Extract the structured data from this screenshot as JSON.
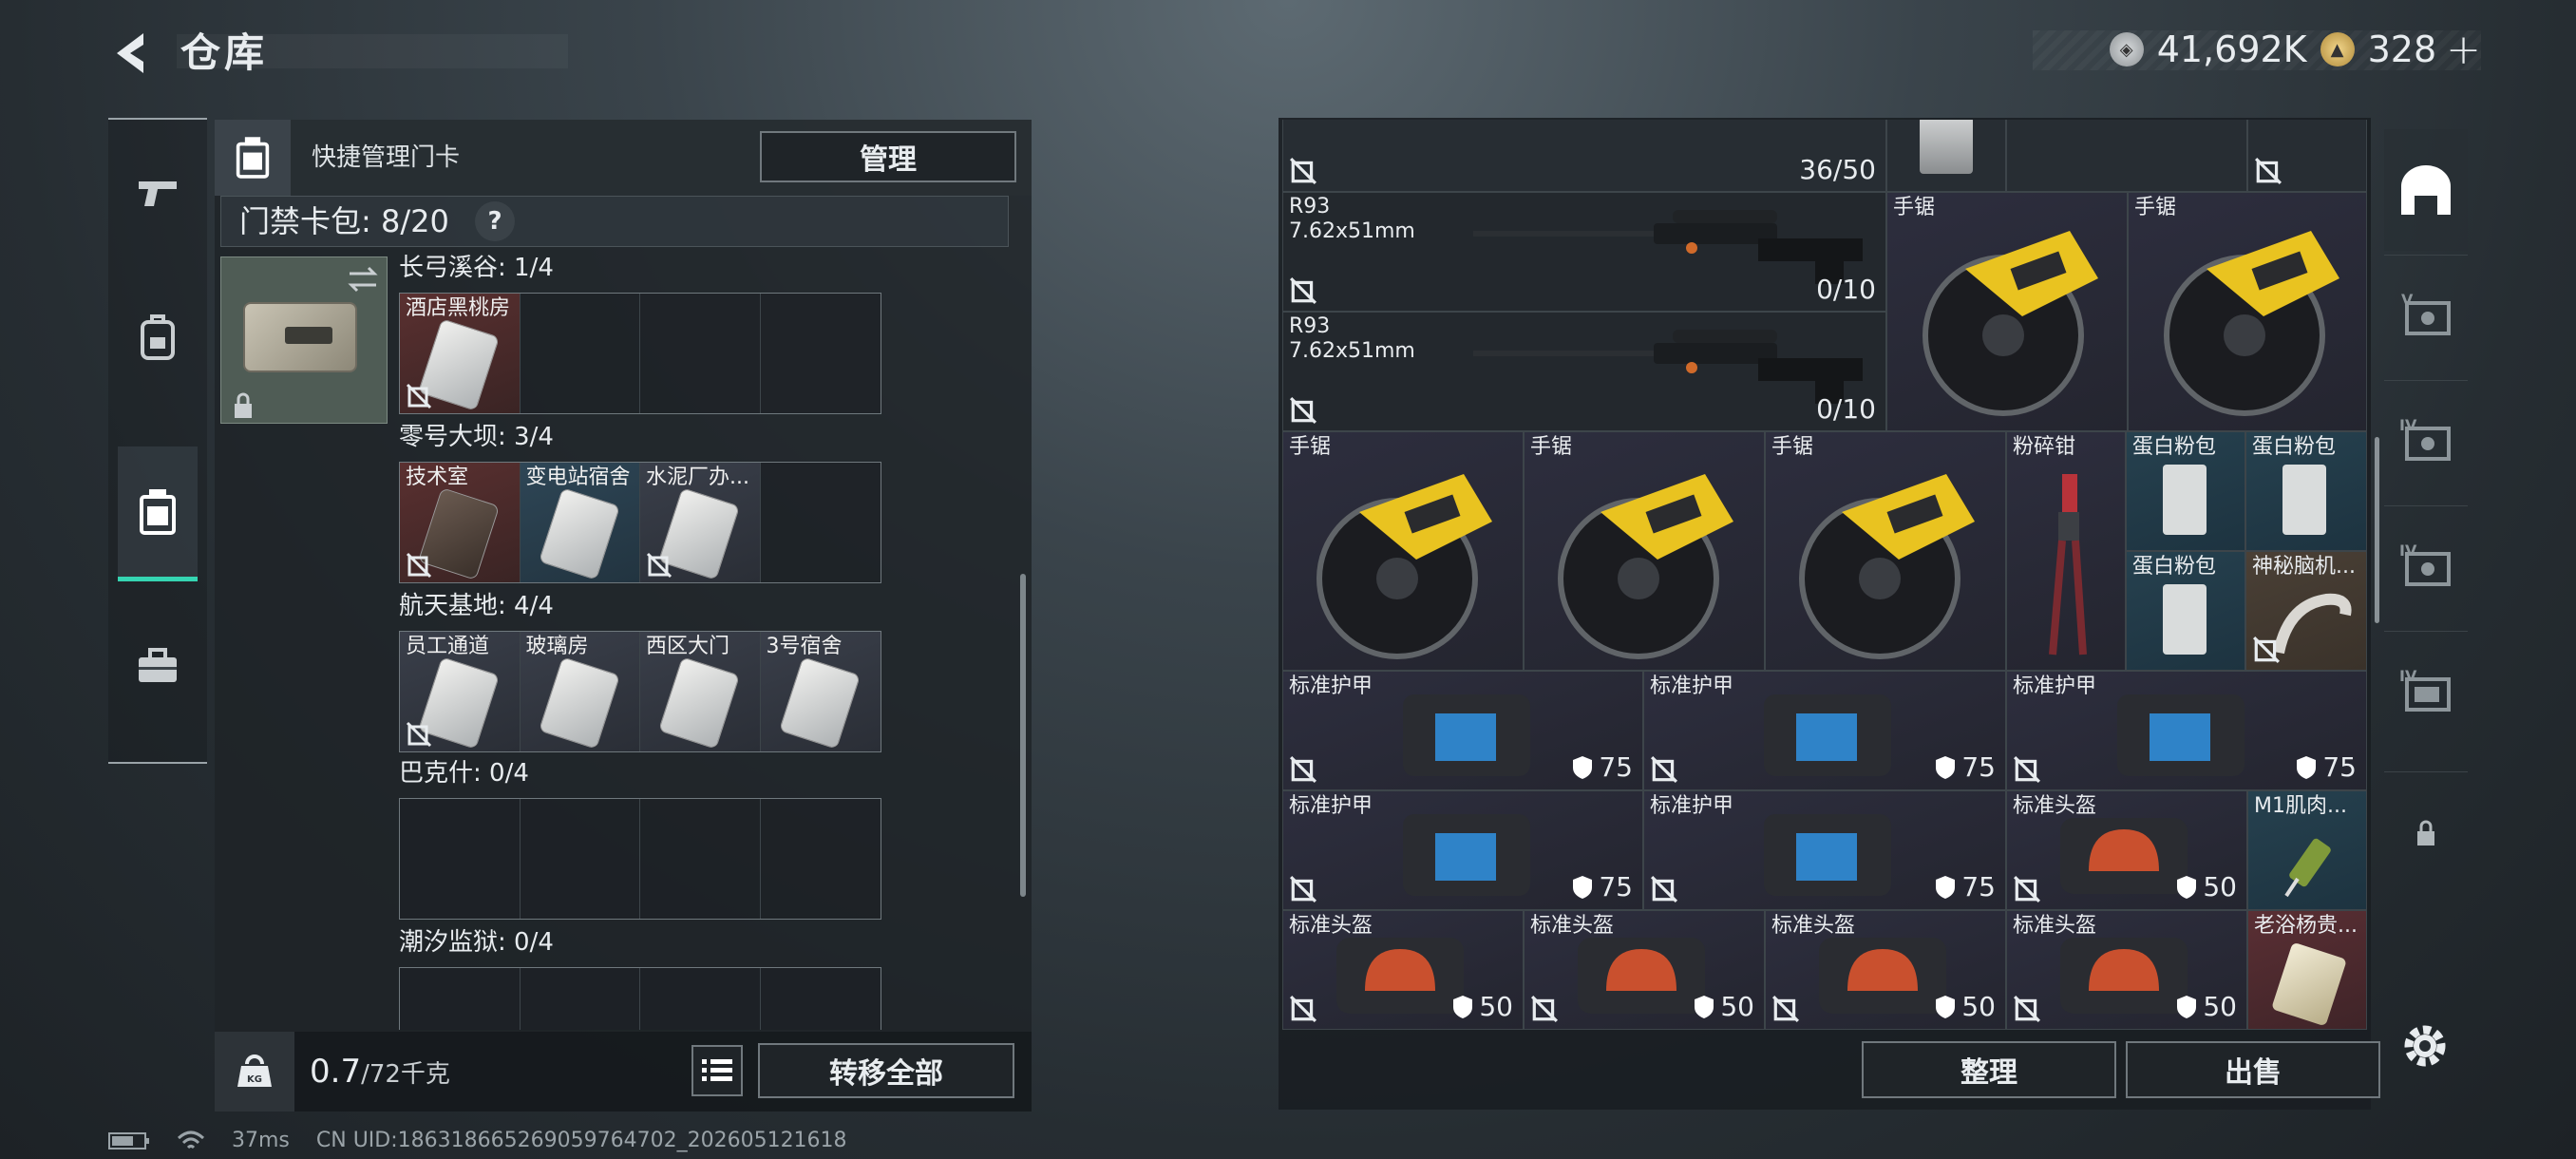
{
  "header": {
    "title": "仓库"
  },
  "currency": {
    "coins": "41,692K",
    "premium": "328"
  },
  "left_panel": {
    "quick_manage_label": "快捷管理门卡",
    "manage_button": "管理",
    "capacity_label": "门禁卡包: 8/20",
    "help_label": "?",
    "regions": [
      {
        "name": "长弓溪谷: 1/4",
        "cards": [
          "酒店黑桃房"
        ]
      },
      {
        "name": "零号大坝: 3/4",
        "cards": [
          "技术室",
          "变电站宿舍",
          "水泥厂办..."
        ]
      },
      {
        "name": "航天基地: 4/4",
        "cards": [
          "员工通道",
          "玻璃房",
          "西区大门",
          "3号宿舍"
        ]
      },
      {
        "name": "巴克什: 0/4",
        "cards": []
      },
      {
        "name": "潮汐监狱: 0/4",
        "cards": []
      }
    ],
    "weight": "0.7",
    "weight_max": "/72千克",
    "transfer_button": "转移全部"
  },
  "inventory": {
    "items": [
      {
        "name": "",
        "qty": "36/50"
      },
      {
        "name": "R93\n7.62x51mm",
        "qty": "0/10"
      },
      {
        "name": "R93\n7.62x51mm",
        "qty": "0/10"
      },
      {
        "name": "手锯"
      },
      {
        "name": "手锯"
      },
      {
        "name": "手锯"
      },
      {
        "name": "手锯"
      },
      {
        "name": "手锯"
      },
      {
        "name": "粉碎钳"
      },
      {
        "name": "蛋白粉包"
      },
      {
        "name": "蛋白粉包"
      },
      {
        "name": "蛋白粉包"
      },
      {
        "name": "神秘脑机..."
      },
      {
        "name": "标准护甲",
        "dur": "75"
      },
      {
        "name": "标准护甲",
        "dur": "75"
      },
      {
        "name": "标准护甲",
        "dur": "75"
      },
      {
        "name": "标准护甲",
        "dur": "75"
      },
      {
        "name": "标准护甲",
        "dur": "75"
      },
      {
        "name": "标准头盔",
        "dur": "50"
      },
      {
        "name": "M1肌肉..."
      },
      {
        "name": "标准头盔",
        "dur": "50"
      },
      {
        "name": "标准头盔",
        "dur": "50"
      },
      {
        "name": "标准头盔",
        "dur": "50"
      },
      {
        "name": "标准头盔",
        "dur": "50"
      },
      {
        "name": "老浴杨贵..."
      }
    ],
    "sort_button": "整理",
    "sell_button": "出售"
  },
  "right_tabs": [
    "V",
    "IV",
    "IV",
    "IV"
  ],
  "status": {
    "ping": "37ms",
    "uid": "CN UID:186318665269059764702_202605121618"
  }
}
